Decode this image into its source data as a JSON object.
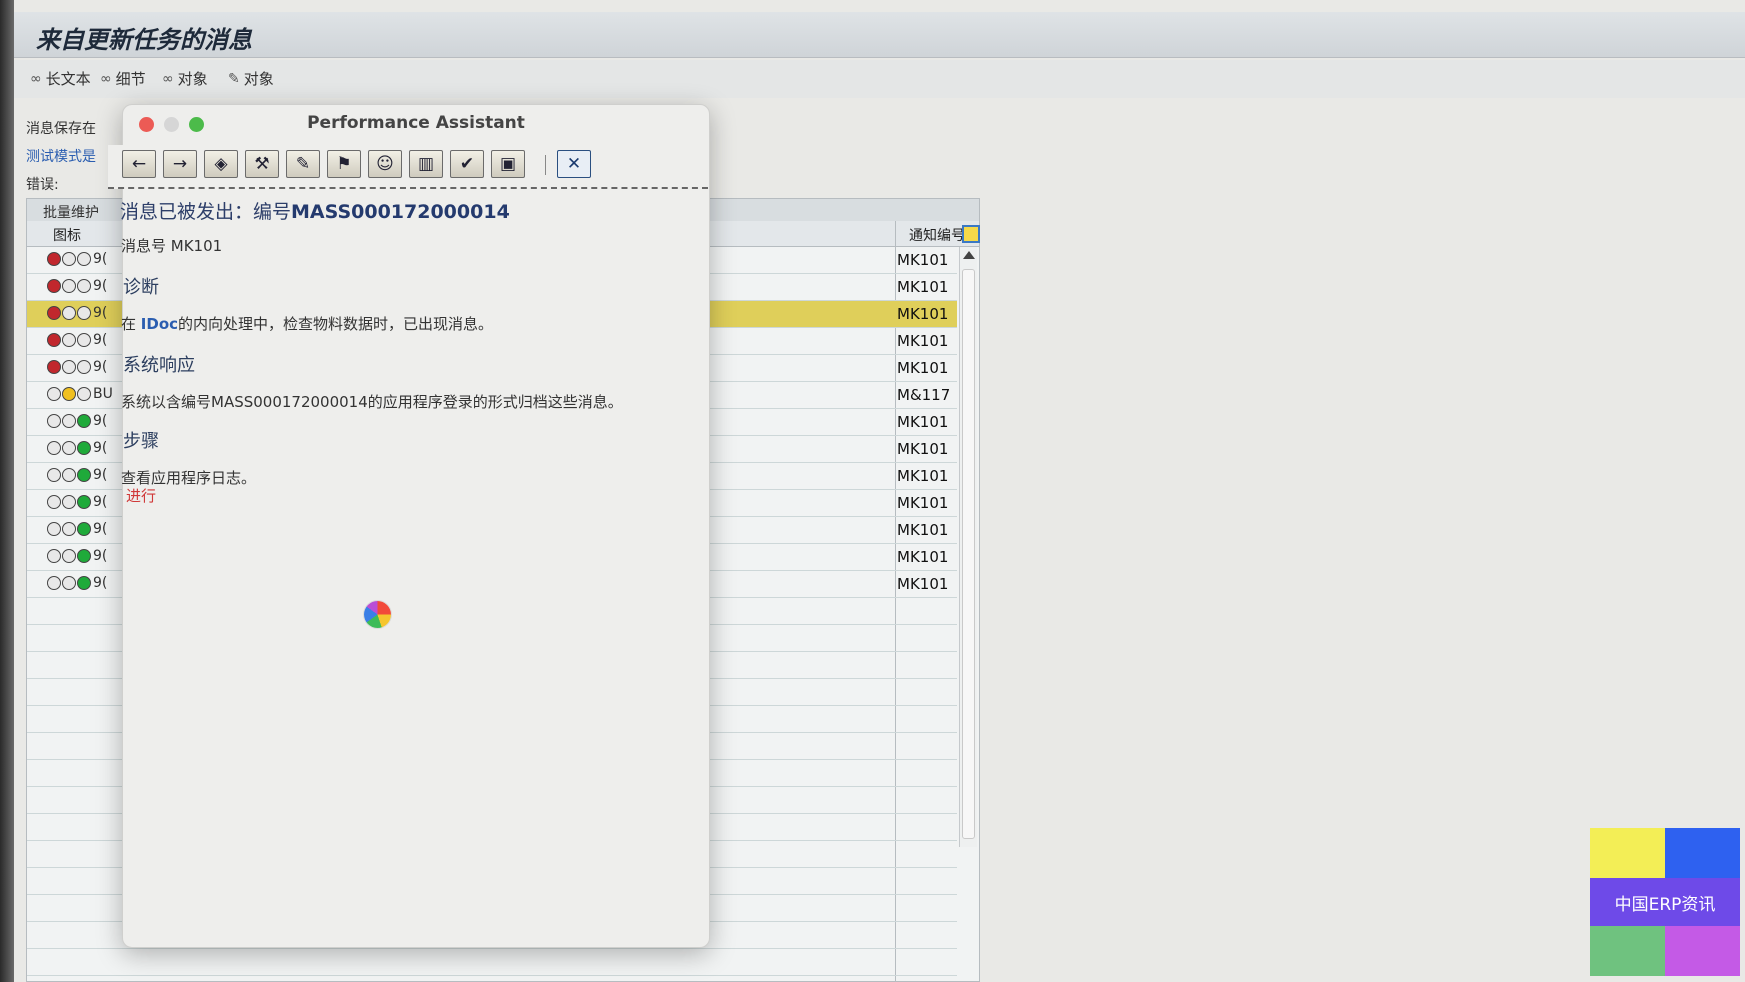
{
  "window": {
    "title": "来自更新任务的消息"
  },
  "toolbar": {
    "items": [
      {
        "label": "长文本"
      },
      {
        "label": "细节"
      },
      {
        "label": "对象"
      },
      {
        "label": "对象"
      }
    ]
  },
  "left_labels": {
    "saved": "消息保存在",
    "test_mode": "测试模式是",
    "errors": "错误:",
    "table_caption": "批量维护",
    "icon_col": "图标"
  },
  "table": {
    "col_notice": "通知编号",
    "rows": [
      {
        "code": "9(",
        "lights": [
          "red",
          "off",
          "off"
        ],
        "msg": "MK101"
      },
      {
        "code": "9(",
        "lights": [
          "red",
          "off",
          "off"
        ],
        "msg": "MK101"
      },
      {
        "code": "9(",
        "lights": [
          "red",
          "off",
          "off"
        ],
        "msg": "MK101",
        "highlight": true
      },
      {
        "code": "9(",
        "lights": [
          "red",
          "off",
          "off"
        ],
        "msg": "MK101"
      },
      {
        "code": "9(",
        "lights": [
          "red",
          "off",
          "off"
        ],
        "msg": "MK101"
      },
      {
        "code": "BU",
        "lights": [
          "off",
          "yellow",
          "off"
        ],
        "msg": "M&117"
      },
      {
        "code": "9(",
        "lights": [
          "off",
          "off",
          "green"
        ],
        "msg": "MK101"
      },
      {
        "code": "9(",
        "lights": [
          "off",
          "off",
          "green"
        ],
        "msg": "MK101"
      },
      {
        "code": "9(",
        "lights": [
          "off",
          "off",
          "green"
        ],
        "msg": "MK101"
      },
      {
        "code": "9(",
        "lights": [
          "off",
          "off",
          "green"
        ],
        "msg": "MK101"
      },
      {
        "code": "9(",
        "lights": [
          "off",
          "off",
          "green"
        ],
        "msg": "MK101"
      },
      {
        "code": "9(",
        "lights": [
          "off",
          "off",
          "green"
        ],
        "msg": "MK101"
      },
      {
        "code": "9(",
        "lights": [
          "off",
          "off",
          "green"
        ],
        "msg": "MK101"
      }
    ]
  },
  "popup": {
    "title": "Performance Assistant",
    "toolbar_icons": [
      "back-arrow-icon",
      "forward-arrow-icon",
      "eraser-icon",
      "tools-icon",
      "edit-icon",
      "flag-icon",
      "user-icon",
      "book-icon",
      "check-card-icon",
      "monitor-icon",
      "print-icon",
      "close-x-icon"
    ],
    "heading_prefix": "消息已被发出：编号",
    "heading_id": "MASS000172000014",
    "msg_no": "消息号 MK101",
    "diagnosis_title": "诊断",
    "diagnosis_text_pre": "在 ",
    "diagnosis_kw": "IDoc",
    "diagnosis_text_post": "的内向处理中，检查物料数据时，已出现消息。",
    "response_title": "系统响应",
    "response_text": "系统以含编号MASS000172000014的应用程序登录的形式归档这些消息。",
    "steps_title": "步骤",
    "steps_text": "查看应用程序日志。",
    "steps_link": "进行"
  },
  "watermark": {
    "text": "中国ERP资讯"
  }
}
